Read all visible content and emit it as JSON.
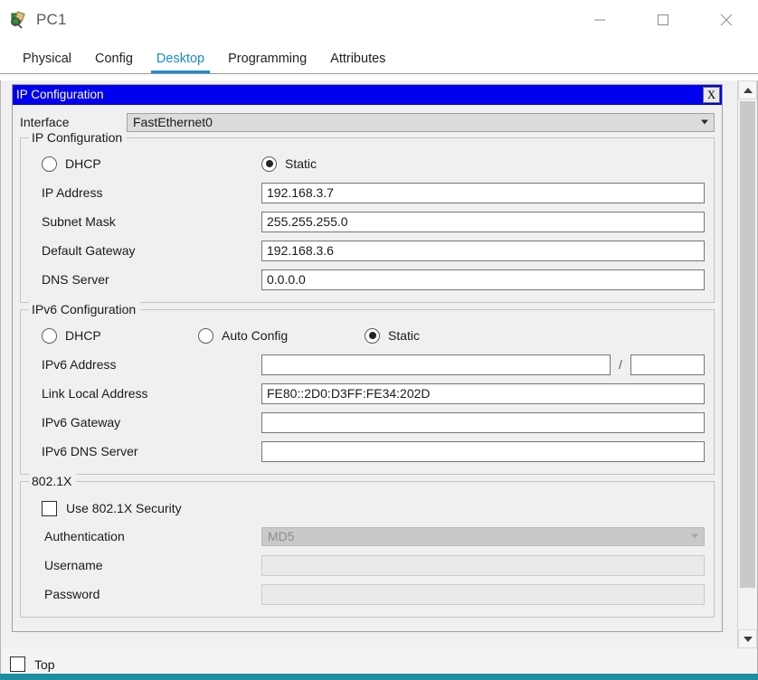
{
  "window": {
    "title": "PC1",
    "icon": "packet-tracer-icon",
    "controls": {
      "minimize": "minimize-icon",
      "maximize": "maximize-icon",
      "close": "close-icon"
    }
  },
  "tabs": [
    {
      "label": "Physical",
      "active": false
    },
    {
      "label": "Config",
      "active": false
    },
    {
      "label": "Desktop",
      "active": true
    },
    {
      "label": "Programming",
      "active": false
    },
    {
      "label": "Attributes",
      "active": false
    }
  ],
  "dialog": {
    "title": "IP Configuration",
    "close_label": "X",
    "interface": {
      "label": "Interface",
      "value": "FastEthernet0"
    },
    "ipv4": {
      "legend": "IP Configuration",
      "dhcp_label": "DHCP",
      "static_label": "Static",
      "mode": "Static",
      "fields": [
        {
          "label": "IP Address",
          "value": "192.168.3.7"
        },
        {
          "label": "Subnet Mask",
          "value": "255.255.255.0"
        },
        {
          "label": "Default Gateway",
          "value": "192.168.3.6"
        },
        {
          "label": "DNS Server",
          "value": "0.0.0.0"
        }
      ]
    },
    "ipv6": {
      "legend": "IPv6 Configuration",
      "dhcp_label": "DHCP",
      "auto_label": "Auto Config",
      "static_label": "Static",
      "mode": "Static",
      "address_label": "IPv6 Address",
      "address_value": "",
      "prefix_separator": "/",
      "prefix_value": "",
      "fields": [
        {
          "label": "Link Local Address",
          "value": "FE80::2D0:D3FF:FE34:202D"
        },
        {
          "label": "IPv6 Gateway",
          "value": ""
        },
        {
          "label": "IPv6 DNS Server",
          "value": ""
        }
      ]
    },
    "dot1x": {
      "legend": "802.1X",
      "use_security_label": "Use 802.1X Security",
      "use_security_checked": false,
      "authentication_label": "Authentication",
      "authentication_value": "MD5",
      "username_label": "Username",
      "username_value": "",
      "password_label": "Password",
      "password_value": ""
    }
  },
  "scrollbar": {
    "up": "chevron-up-icon",
    "down": "chevron-down-icon"
  },
  "bottom": {
    "top_label": "Top",
    "top_checked": false
  },
  "colors": {
    "accent_blue": "#1a8ad0",
    "dialog_title_bg": "#0000ef",
    "teal_strip": "#1e8fa3"
  }
}
